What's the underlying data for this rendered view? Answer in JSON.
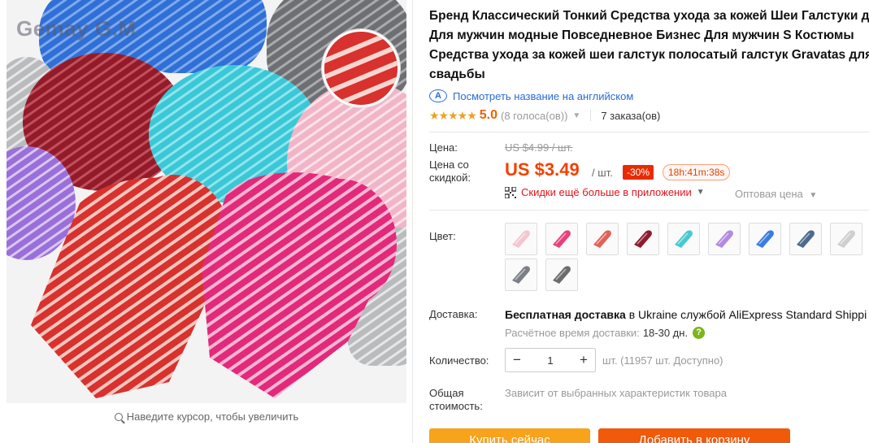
{
  "gallery": {
    "watermark": "Gemay G.M",
    "hover_hint": "Наведите курсор, чтобы увеличить"
  },
  "product": {
    "title_lines": [
      "Бренд Классический Тонкий Средства ухода за кожей Шеи Галстуки д",
      "Для мужчин модные Повседневное Бизнес Для мужчин S Костюмы",
      "Средства ухода за кожей шеи галстук полосатый галстук Gravatas для",
      "свадьбы"
    ],
    "translate_link": "Посмотреть название на английском",
    "rating": {
      "stars": "★★★★★",
      "value": "5.0",
      "votes": "(8 голоса(ов))",
      "orders": "7 заказа(ов)"
    }
  },
  "pricing": {
    "price_label": "Цена:",
    "old_price": "US $4.99 / шт.",
    "discount_label_line1": "Цена со",
    "discount_label_line2": "скидкой:",
    "price": "US $3.49",
    "per_unit": "/ шт.",
    "discount_badge": "-30%",
    "timer": "18h:41m:38s",
    "app_discount": "Скидки ещё больше в приложении",
    "wholesale": "Оптовая цена"
  },
  "color": {
    "label": "Цвет:",
    "swatches": [
      {
        "name": "light-pink",
        "color": "#f4c6cf"
      },
      {
        "name": "hot-pink",
        "color": "#e8417a"
      },
      {
        "name": "coral",
        "color": "#e06258"
      },
      {
        "name": "wine",
        "color": "#8e1c2e"
      },
      {
        "name": "turquoise",
        "color": "#48c9d2"
      },
      {
        "name": "lavender",
        "color": "#b48ae0"
      },
      {
        "name": "blue",
        "color": "#3a7de0"
      },
      {
        "name": "steel-blue",
        "color": "#4d6a8e"
      },
      {
        "name": "silver",
        "color": "#cfcfcf"
      },
      {
        "name": "grey",
        "color": "#7b7f86"
      },
      {
        "name": "dark-grey",
        "color": "#6a6d6a"
      }
    ]
  },
  "shipping": {
    "label": "Доставка:",
    "free": "Бесплатная доставка",
    "to": "в Ukraine службой AliExpress Standard Shippi",
    "eta_label": "Расчётное время доставки:",
    "eta_days": "18-30 дн.",
    "help": "?"
  },
  "quantity": {
    "label": "Количество:",
    "minus": "−",
    "value": "1",
    "plus": "+",
    "available": "шт. (11957 шт. Доступно)"
  },
  "total": {
    "label_line1": "Общая",
    "label_line2": "стоимость:",
    "note": "Зависит от выбранных характеристик товара"
  },
  "actions": {
    "buy": "Купить сейчас",
    "cart": "Добавить в корзину"
  },
  "colors": {
    "price_red": "#f34100",
    "rating_orange": "#f26100",
    "link_blue": "#2a6bd3",
    "buy_button": "#f7a31b",
    "cart_button": "#f15a0a"
  }
}
